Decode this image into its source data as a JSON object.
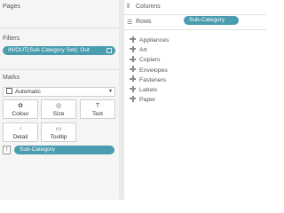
{
  "left_panel": {
    "pages_title": "Pages",
    "filters_title": "Filters",
    "filter_pill": "IN/OUT(Sub Category Set): Out",
    "marks_title": "Marks",
    "mark_type": "Automatic",
    "cards": [
      {
        "label": "Colour",
        "icon": "palette-icon"
      },
      {
        "label": "Size",
        "icon": "size-icon"
      },
      {
        "label": "Text",
        "icon": "text-icon"
      },
      {
        "label": "Detail",
        "icon": "detail-icon"
      },
      {
        "label": "Tooltip",
        "icon": "tooltip-icon"
      }
    ],
    "marks_pill": "Sub-Category"
  },
  "shelves": {
    "columns_label": "Columns",
    "rows_label": "Rows",
    "rows_pill": "Sub-Category"
  },
  "view": {
    "items": [
      "Appliances",
      "Art",
      "Copiers",
      "Envelopes",
      "Fasteners",
      "Labels",
      "Paper"
    ]
  },
  "colors": {
    "pill": "#4a9db0",
    "panel_bg": "#f5f5f5"
  }
}
